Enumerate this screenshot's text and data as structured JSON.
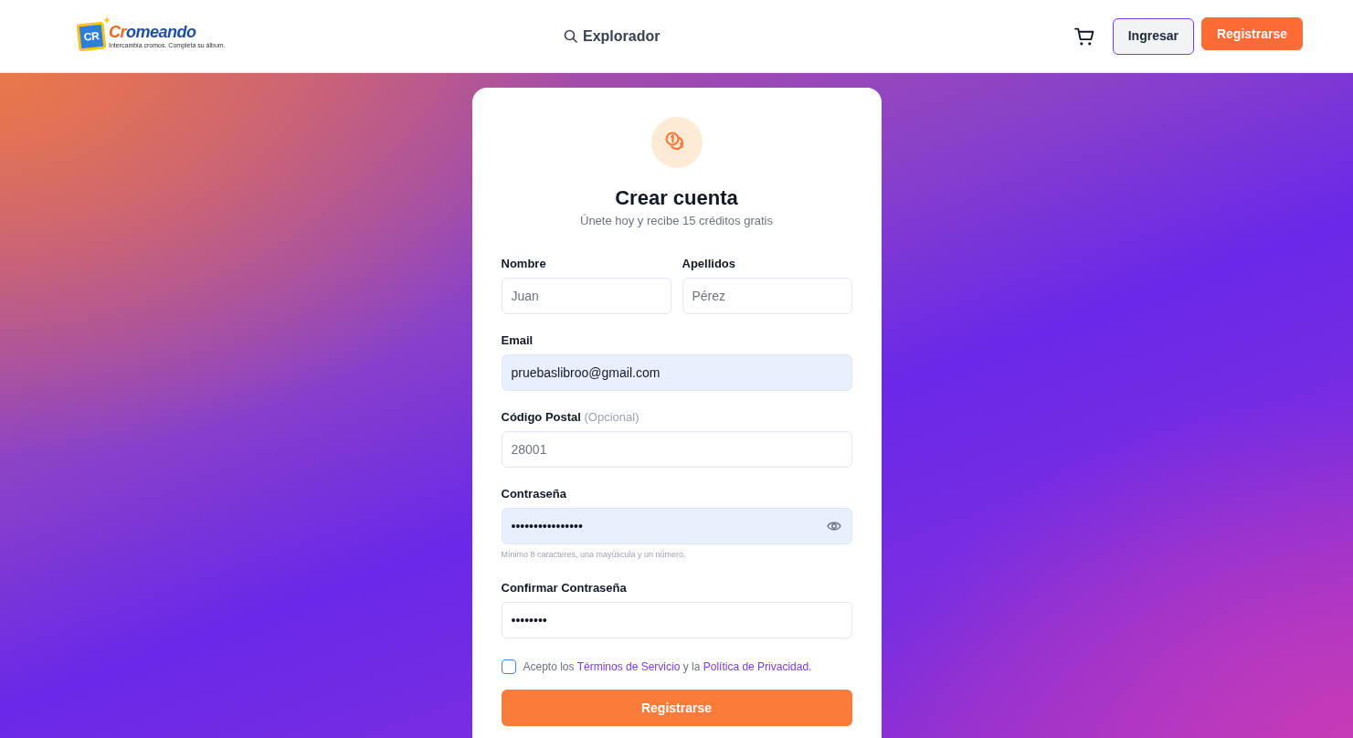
{
  "navbar": {
    "logo": {
      "badge": "CR",
      "wordmark_parts": [
        "Cr",
        "omeando"
      ],
      "tagline": "Intercambia cromos. Completa su álbum."
    },
    "explore_link": "Explorador",
    "buttons": [
      {
        "label": "Ingresar",
        "kind": "secondary"
      },
      {
        "label": "Registrarse",
        "kind": "primary"
      }
    ]
  },
  "signup_card": {
    "title": "Crear cuenta",
    "subtitle": "Únete hoy y recibe 15 créditos gratis",
    "rows": [
      {
        "fields": [
          {
            "label": "Nombre",
            "placeholder": "Juan",
            "autofilled": false
          },
          {
            "label": "Apellidos",
            "placeholder": "Pérez",
            "autofilled": false
          }
        ]
      },
      {
        "fields": [
          {
            "label": "Email",
            "value": "pruebaslibroo@gmail.com",
            "autofilled": true
          }
        ]
      },
      {
        "fields": [
          {
            "label": "Código Postal",
            "label_note": "(Opcional)",
            "placeholder": "28001",
            "autofilled": false
          }
        ]
      },
      {
        "fields": [
          {
            "label": "Contraseña",
            "value": "••••••••••••••••",
            "autofilled": true,
            "reveal_toggle": true,
            "hint": "Mínimo 8 caracteres, una mayúscula y un número."
          }
        ]
      },
      {
        "fields": [
          {
            "label": "Confirmar Contraseña",
            "value": "••••••••",
            "autofilled": false
          }
        ]
      }
    ],
    "consent": {
      "checked": false,
      "parts": [
        {
          "text": "Acepto los ",
          "kind": "text"
        },
        {
          "text": "Términos de Servicio",
          "kind": "link"
        },
        {
          "text": " y la ",
          "kind": "text"
        },
        {
          "text": "Política de Privacidad.",
          "kind": "link"
        }
      ]
    },
    "submit": "Registrarse"
  }
}
